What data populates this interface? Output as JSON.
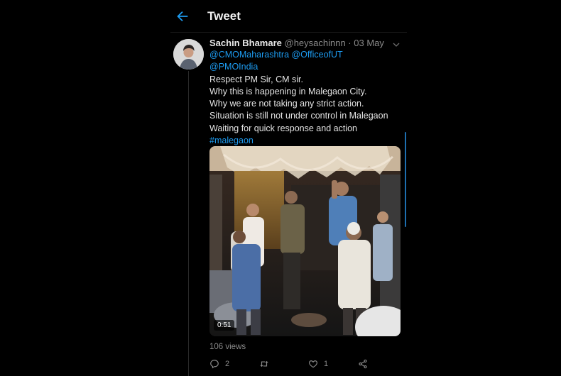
{
  "header": {
    "title": "Tweet"
  },
  "tweet": {
    "author_name": "Sachin Bhamare",
    "author_meta": "@heysachinnn · 03 May",
    "mentions_line1": "@CMOMaharashtra @OfficeofUT",
    "mentions_line2": "@PMOIndia",
    "lines": [
      "Respect PM Sir, CM sir.",
      "Why this is happening in Malegaon City.",
      "Why we are not taking any strict action.",
      "Situation is still not under control in Malegaon",
      "Waiting for quick response and action"
    ],
    "hashtag": "#malegaon",
    "video_duration": "0:51",
    "views": "106 views",
    "reply_count": "2",
    "like_count": "1"
  },
  "icons": {
    "back": "arrow-left-icon",
    "caret": "chevron-down-icon",
    "reply": "reply-icon",
    "retweet": "retweet-icon",
    "like": "heart-icon",
    "share": "share-icon"
  },
  "colors": {
    "accent": "#1d9bf0",
    "background": "#000000",
    "muted": "#8a8a8a"
  }
}
